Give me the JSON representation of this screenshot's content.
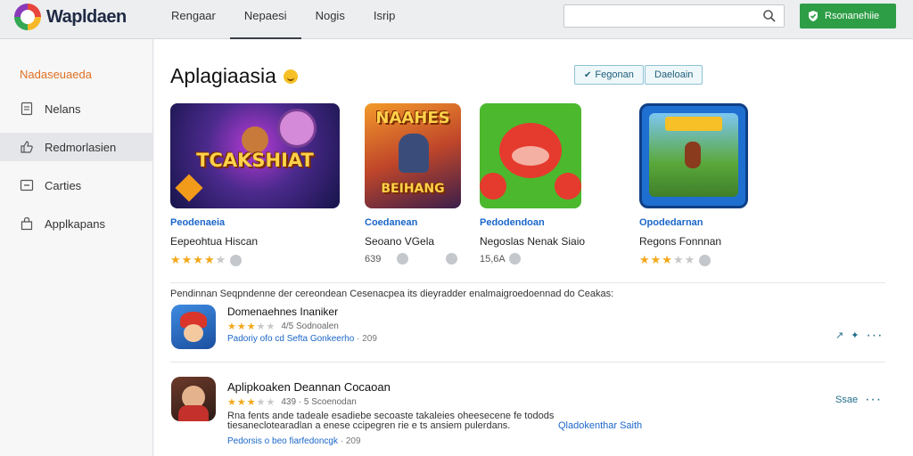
{
  "app": {
    "name": "Wapldaen"
  },
  "topnav": [
    {
      "label": "Rengaar",
      "active": false
    },
    {
      "label": "Nepaesi",
      "active": true
    },
    {
      "label": "Nogis",
      "active": false
    },
    {
      "label": "Isrip",
      "active": false
    }
  ],
  "search": {
    "placeholder": "",
    "value": ""
  },
  "install_button": {
    "label": "Rsonanehiie"
  },
  "sidebar": {
    "heading": "Nadaseuaeda",
    "items": [
      {
        "label": "Nelans",
        "icon": "document-icon",
        "active": false
      },
      {
        "label": "Redmorlasien",
        "icon": "thumbs-up-icon",
        "active": true
      },
      {
        "label": "Carties",
        "icon": "minus-box-icon",
        "active": false
      },
      {
        "label": "Applkapans",
        "icon": "bag-icon",
        "active": false
      }
    ]
  },
  "page": {
    "title": "Aplagiaasia",
    "buttons": [
      {
        "label": "Fegonan",
        "icon": "check-icon"
      },
      {
        "label": "Daeloain",
        "icon": ""
      }
    ]
  },
  "featured": [
    {
      "art_text": "TCAKSHIAT",
      "category": "Peodenaeia",
      "name": "Eepeohtua Hiscan",
      "rating": 4,
      "meta": ""
    },
    {
      "art_top": "NAAHES",
      "art_bottom": "BEIHANG",
      "category": "Coedanean",
      "name": "Seoano VGela",
      "rating": 0,
      "meta": "639"
    },
    {
      "art_text": "",
      "category": "Pedodendoan",
      "name": "Negoslas Nenak Siaio",
      "rating": 0,
      "meta": "15,6A"
    },
    {
      "art_text": "",
      "category": "Opodedarnan",
      "name": "Regons Fonnnan",
      "rating": 3,
      "meta": ""
    }
  ],
  "section_description": "Pendinnan Seqpndenne der cereondean Cesenacpea its dieyradder enalmaigroedoennad do Ceakas:",
  "list": [
    {
      "title": "Domenaehnes Inaniker",
      "rating": 3,
      "reviews": "4/5 Sodnoalen",
      "link": "Padoriy ofo cd Sefta Gonkeerho",
      "link_suffix": "· 209",
      "actions_label": "",
      "description": "",
      "side_link": ""
    },
    {
      "title": "Aplipkoaken Deannan Cocaoan",
      "rating": 3,
      "reviews": "439 · 5 Scoenodan",
      "description": "Rna fents ande tadeale esadiebe secoaste takaleies oheesecene fe todods tiesaneclotearadlan a enese ccipegren rie e ts ansiem pulerdans.",
      "side_link": "Qladokenthar Saith",
      "link": "Pedorsis o beo fiarfedoncgk",
      "link_suffix": "· 209",
      "actions_label": "Ssae"
    }
  ],
  "colors": {
    "accent": "#2e9e46",
    "link": "#1b66c9",
    "star": "#f3a81a",
    "brand_orange": "#e07020"
  }
}
